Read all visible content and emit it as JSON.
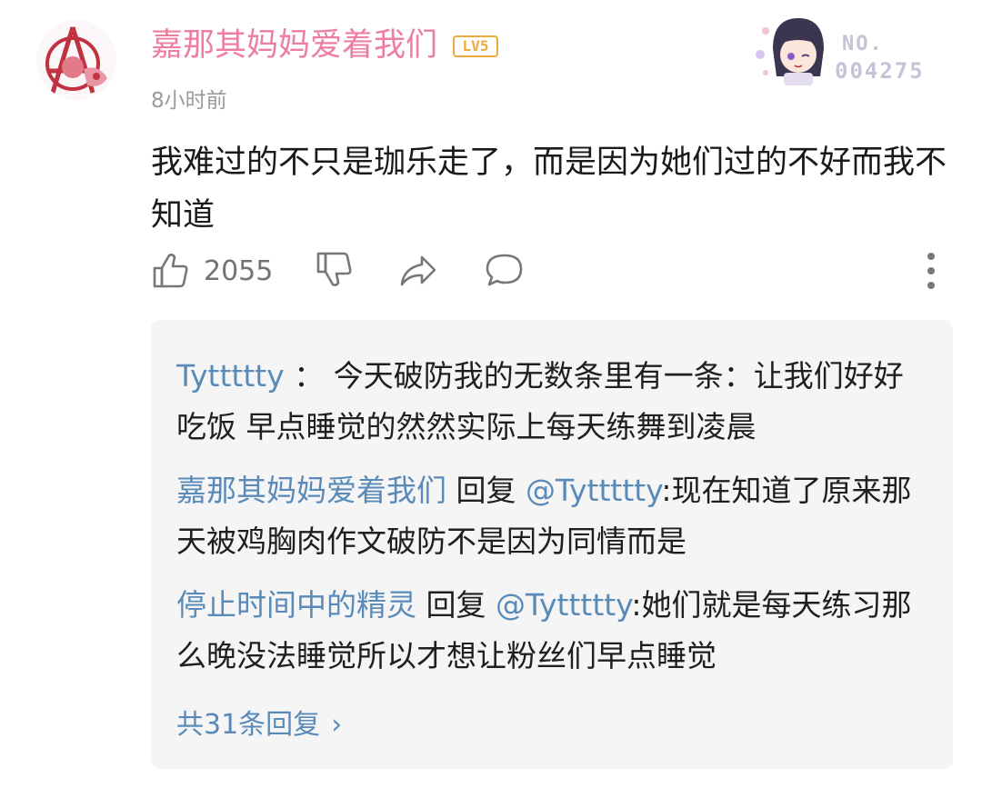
{
  "comment": {
    "username": "嘉那其妈妈爱着我们",
    "level": "LV5",
    "time": "8小时前",
    "text": "我难过的不只是珈乐走了，而是因为她们过的不好而我不知道",
    "like_count": "2055",
    "fan_badge": {
      "label": "NO.",
      "number": "004275"
    }
  },
  "replies": [
    {
      "author": "Tyttttty",
      "separator": " ： ",
      "reply_word": "",
      "mention": "",
      "text": "今天破防我的无数条里有一条：让我们好好吃饭 早点睡觉的然然实际上每天练舞到凌晨"
    },
    {
      "author": "嘉那其妈妈爱着我们",
      "separator": "",
      "reply_word": " 回复 ",
      "mention": "@Tyttttty",
      "text": ":现在知道了原来那天被鸡胸肉作文破防不是因为同情而是"
    },
    {
      "author": "停止时间中的精灵",
      "separator": "",
      "reply_word": " 回复 ",
      "mention": "@Tyttttty",
      "text": ":她们就是每天练习那么晚没法睡觉所以才想让粉丝们早点睡觉"
    }
  ],
  "view_all": "共31条回复",
  "view_all_chevron": "›",
  "icons": [
    "avatar-emblem",
    "thumbs-up-icon",
    "thumbs-down-icon",
    "share-icon",
    "comment-icon",
    "more-vertical-icon",
    "chevron-right-icon"
  ],
  "colors": {
    "username": "#ec7fa0",
    "link": "#5a8bb8",
    "level": "#f0a93a",
    "muted": "#9b9b9b"
  }
}
